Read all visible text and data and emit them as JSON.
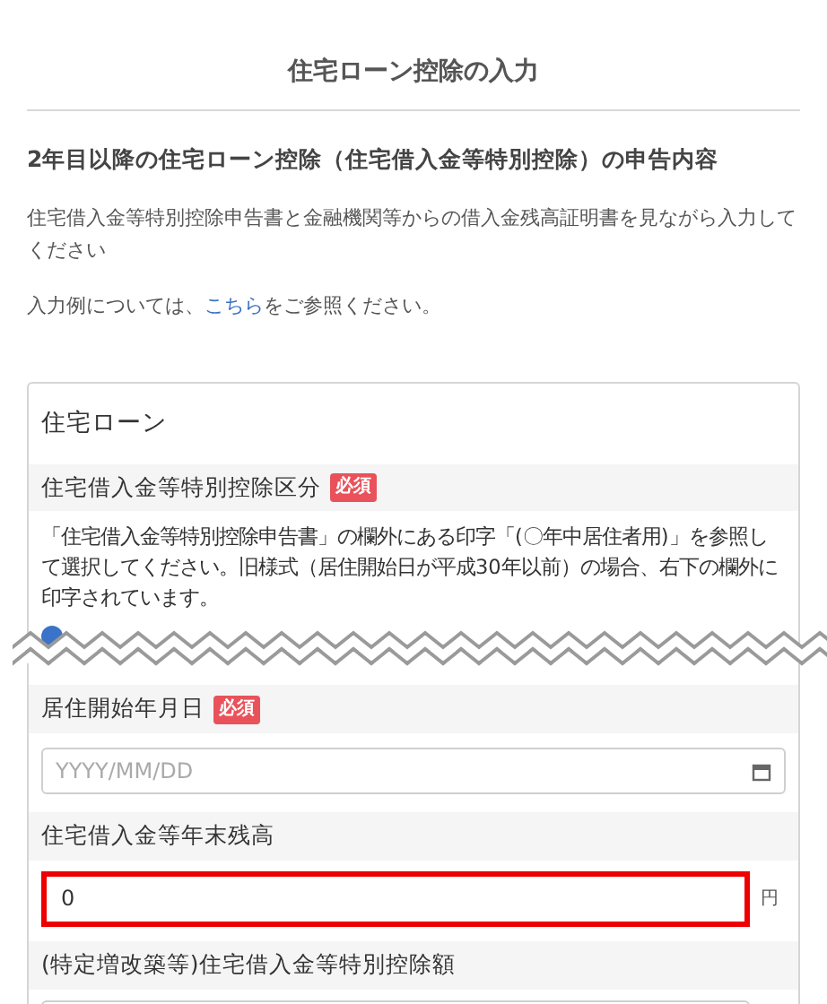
{
  "page_title": "住宅ローン控除の入力",
  "heading": "2年目以降の住宅ローン控除（住宅借入金等特別控除）の申告内容",
  "intro": "住宅借入金等特別控除申告書と金融機関等からの借入金残高証明書を見ながら入力してください",
  "example_note": {
    "before": "入力例については、",
    "link": "こちら",
    "after": "をご参照ください。"
  },
  "card": {
    "title": "住宅ローン",
    "fields": [
      {
        "kind": "select",
        "label": "住宅借入金等特別控除区分",
        "required_label": "必須",
        "description": "「住宅借入金等特別控除申告書」の欄外にある印字「(〇年中居住者用)」を参照して選択してください。旧様式（居住開始日が平成30年以前）の場合、右下の欄外に印字されています。"
      },
      {
        "kind": "date",
        "label": "居住開始年月日",
        "required_label": "必須",
        "placeholder": "YYYY/MM/DD"
      },
      {
        "kind": "amount",
        "label": "住宅借入金等年末残高",
        "value": "0",
        "unit": "円",
        "error": true
      },
      {
        "kind": "amount",
        "label": "(特定増改築等)住宅借入金等特別控除額",
        "error": false
      }
    ]
  }
}
